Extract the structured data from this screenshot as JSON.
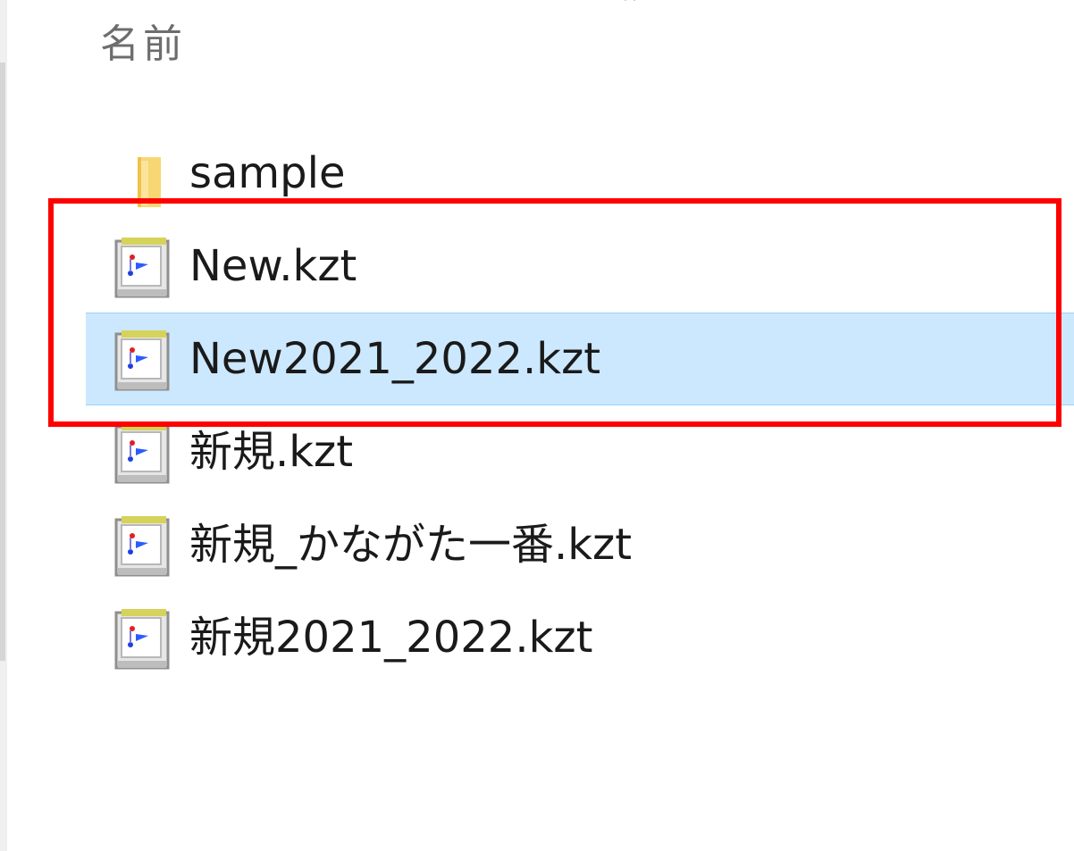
{
  "header": {
    "name_column": "名前",
    "sort_glyph": "^"
  },
  "files": [
    {
      "name": "sample",
      "type": "folder",
      "icon": "folder-icon"
    },
    {
      "name": "New.kzt",
      "type": "kzt",
      "icon": "kzt-file-icon"
    },
    {
      "name": "New2021_2022.kzt",
      "type": "kzt",
      "icon": "kzt-file-icon",
      "selected": true
    },
    {
      "name": "新規.kzt",
      "type": "kzt",
      "icon": "kzt-file-icon"
    },
    {
      "name": "新規_かながた一番.kzt",
      "type": "kzt",
      "icon": "kzt-file-icon"
    },
    {
      "name": "新規2021_2022.kzt",
      "type": "kzt",
      "icon": "kzt-file-icon"
    }
  ],
  "colors": {
    "selection_bg": "#cce8ff",
    "selection_border": "#99d1ff",
    "annotation_red": "#ff0000",
    "folder_yellow": "#f7d774"
  }
}
